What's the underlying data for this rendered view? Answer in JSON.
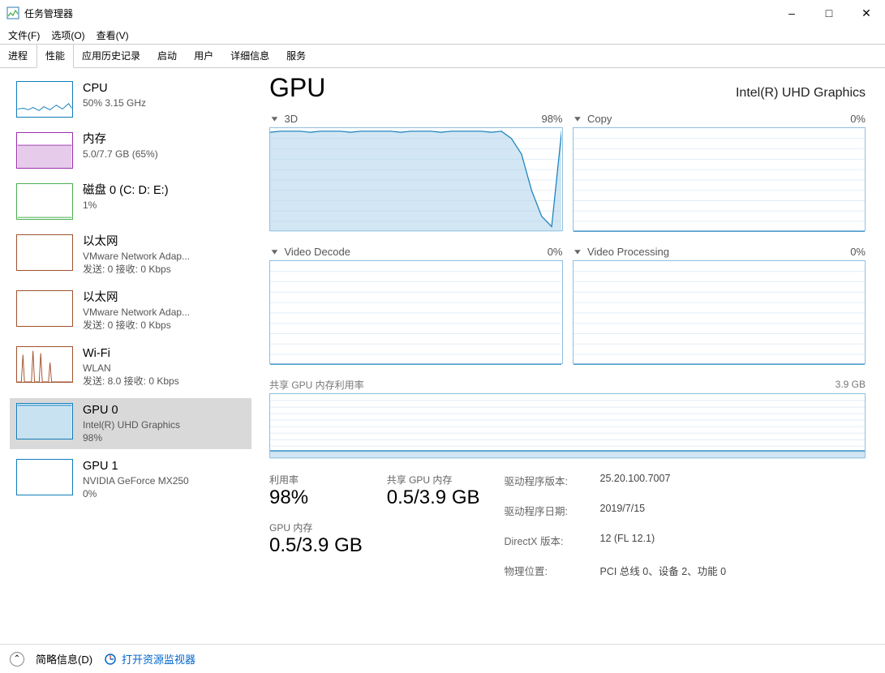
{
  "window": {
    "title": "任务管理器"
  },
  "menu": {
    "file": "文件(F)",
    "options": "选项(O)",
    "view": "查看(V)"
  },
  "tabs": [
    "进程",
    "性能",
    "应用历史记录",
    "启动",
    "用户",
    "详细信息",
    "服务"
  ],
  "active_tab": 1,
  "sidebar": [
    {
      "title": "CPU",
      "sub": "50% 3.15 GHz",
      "color": "#117dbb",
      "kind": "cpu"
    },
    {
      "title": "内存",
      "sub": "5.0/7.7 GB (65%)",
      "color": "#9b2fae",
      "kind": "mem"
    },
    {
      "title": "磁盘 0 (C: D: E:)",
      "sub": "1%",
      "color": "#4caf50",
      "kind": "disk"
    },
    {
      "title": "以太网",
      "sub_html": "VMware Network Adap...",
      "net": {
        "send": "0",
        "recv": "0 Kbps"
      },
      "color": "#a0522d",
      "kind": "net_flat"
    },
    {
      "title": "以太网",
      "sub_html": "VMware Network Adap...",
      "net": {
        "send": "0",
        "recv": "0 Kbps"
      },
      "color": "#a0522d",
      "kind": "net_flat"
    },
    {
      "title": "Wi-Fi",
      "sub_html": "WLAN",
      "net": {
        "send": "8.0",
        "recv": "0 Kbps"
      },
      "color": "#a0522d",
      "kind": "net_spike"
    },
    {
      "title": "GPU 0",
      "sub_html": "Intel(R) UHD Graphics",
      "sub2": "98%",
      "color": "#117dbb",
      "kind": "gpu_full",
      "selected": true
    },
    {
      "title": "GPU 1",
      "sub_html": "NVIDIA GeForce MX250",
      "sub2": "0%",
      "color": "#117dbb",
      "kind": "gpu_empty"
    }
  ],
  "labels": {
    "send": "发送:",
    "recv": "接收:"
  },
  "main": {
    "title": "GPU",
    "subtitle": "Intel(R) UHD Graphics",
    "charts": [
      {
        "name": "3D",
        "pct": "98%"
      },
      {
        "name": "Copy",
        "pct": "0%"
      },
      {
        "name": "Video Decode",
        "pct": "0%"
      },
      {
        "name": "Video Processing",
        "pct": "0%"
      }
    ],
    "mem_chart": {
      "name": "共享 GPU 内存利用率",
      "max": "3.9 GB"
    },
    "stats": {
      "util_label": "利用率",
      "util_value": "98%",
      "shared_label": "共享 GPU 内存",
      "shared_value": "0.5/3.9 GB",
      "gpu_mem_label": "GPU 内存",
      "gpu_mem_value": "0.5/3.9 GB"
    },
    "details": [
      {
        "k": "驱动程序版本:",
        "v": "25.20.100.7007"
      },
      {
        "k": "驱动程序日期:",
        "v": "2019/7/15"
      },
      {
        "k": "DirectX 版本:",
        "v": "12 (FL 12.1)"
      },
      {
        "k": "物理位置:",
        "v": "PCI 总线 0、设备 2、功能 0"
      }
    ]
  },
  "footer": {
    "brief": "简略信息(D)",
    "resmon": "打开资源监视器"
  },
  "chart_data": {
    "type": "area",
    "series": [
      {
        "name": "3D",
        "ylim": [
          0,
          100
        ],
        "values": [
          96,
          97,
          97,
          97,
          96,
          97,
          97,
          97,
          96,
          97,
          97,
          97,
          97,
          96,
          97,
          97,
          97,
          96,
          97,
          97,
          97,
          97,
          96,
          97,
          90,
          75,
          40,
          15,
          5,
          98
        ]
      },
      {
        "name": "Copy",
        "ylim": [
          0,
          100
        ],
        "values": [
          0,
          0,
          0,
          0,
          0,
          0,
          0,
          0,
          0,
          0,
          0,
          0,
          0,
          0,
          0,
          0,
          0,
          0,
          0,
          0,
          0,
          0,
          0,
          0,
          0,
          0,
          0,
          0,
          0,
          0
        ]
      },
      {
        "name": "Video Decode",
        "ylim": [
          0,
          100
        ],
        "values": [
          0,
          0,
          0,
          0,
          0,
          0,
          0,
          0,
          0,
          0,
          0,
          0,
          0,
          0,
          0,
          0,
          0,
          0,
          0,
          0,
          0,
          0,
          0,
          0,
          0,
          0,
          0,
          0,
          0,
          0
        ]
      },
      {
        "name": "Video Processing",
        "ylim": [
          0,
          100
        ],
        "values": [
          0,
          0,
          0,
          0,
          0,
          0,
          0,
          0,
          0,
          0,
          0,
          0,
          0,
          0,
          0,
          0,
          0,
          0,
          0,
          0,
          0,
          0,
          0,
          0,
          0,
          0,
          0,
          0,
          0,
          0
        ]
      },
      {
        "name": "Shared GPU Memory",
        "ylim": [
          0,
          3.9
        ],
        "values": [
          0.5,
          0.5,
          0.5,
          0.5,
          0.5,
          0.5,
          0.5,
          0.5,
          0.5,
          0.5,
          0.5,
          0.5,
          0.5,
          0.5,
          0.5,
          0.5,
          0.5,
          0.5,
          0.5,
          0.5,
          0.5,
          0.5,
          0.5,
          0.5,
          0.5,
          0.5,
          0.5,
          0.5,
          0.5,
          0.5
        ]
      }
    ]
  }
}
